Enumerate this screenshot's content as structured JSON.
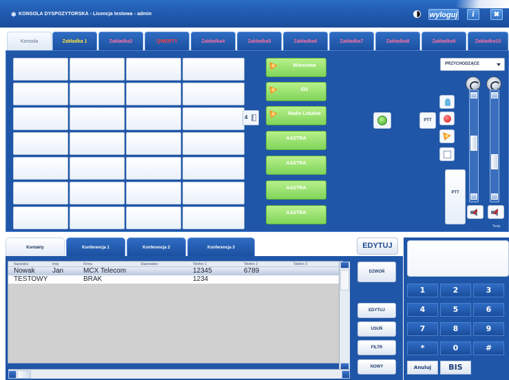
{
  "window": {
    "title": "KONSOLA DYSPOZYTORSKA - Licencja testowa - admin",
    "logout_label": "wyloguj",
    "info_label": "i",
    "close_label": "✖"
  },
  "tabs": [
    {
      "label": "Konsola",
      "color": "#5a6f8f",
      "active": true
    },
    {
      "label": "Zakładka 1",
      "color": "#ffe23a"
    },
    {
      "label": "Zakładka2",
      "color": "#ff6fa0"
    },
    {
      "label": "QWERTY",
      "color": "#ff3a3a"
    },
    {
      "label": "Zakładka4",
      "color": "#ff6fa0"
    },
    {
      "label": "Zakładka5",
      "color": "#ff6fa0"
    },
    {
      "label": "Zakładka6",
      "color": "#ff6fa0"
    },
    {
      "label": "Zakładka7",
      "color": "#ff6fa0"
    },
    {
      "label": "Zakładka8",
      "color": "#ff6fa0"
    },
    {
      "label": "Zakładka9",
      "color": "#ff6fa0"
    },
    {
      "label": "Zakładka10",
      "color": "#ff6fa0"
    }
  ],
  "groups": [
    {
      "label": "Wieszowa",
      "icon": true
    },
    {
      "label": "ID2",
      "icon": true
    },
    {
      "label": "Radio Lokalne",
      "icon": true
    },
    {
      "label": "AASTRA",
      "icon": false
    },
    {
      "label": "AASTRA",
      "icon": false
    },
    {
      "label": "AASTRA",
      "icon": false
    },
    {
      "label": "AASTRA",
      "icon": false
    }
  ],
  "speaker_number": "4",
  "ptt_label": "PTT",
  "ptt_large_label": "PTT",
  "direction_select": "PRZYCHODZĄCE",
  "volume": {
    "left_level": 0.45,
    "right_level": 0.25
  },
  "scale_label": "Testy",
  "contact_tabs": [
    {
      "label": "Kontakty",
      "active": true
    },
    {
      "label": "Konferencja 1"
    },
    {
      "label": "Konferencja 2"
    },
    {
      "label": "Konferencja 3"
    }
  ],
  "table": {
    "columns": [
      "Nazwisko",
      "Imię",
      "Firma",
      "Stanowisko",
      "Telefon 1",
      "Telefon 2",
      "Telefon 3"
    ],
    "rows": [
      [
        "Nowak",
        "Jan",
        "MCX Telecom",
        "",
        "12345",
        "6789",
        ""
      ],
      [
        "TESTOWY",
        "",
        "BRAK",
        "",
        "1234",
        "",
        ""
      ]
    ]
  },
  "edit_big_label": "EDYTUJ",
  "side_buttons": {
    "call": "DZWOŃ",
    "edit": "EDYTUJ",
    "delete": "USUŃ",
    "filter": "FILTR",
    "new": "NOWY"
  },
  "dialpad": {
    "keys": [
      "1",
      "2",
      "3",
      "4",
      "5",
      "6",
      "7",
      "8",
      "9",
      "*",
      "0",
      "#"
    ],
    "cancel": "Anuluj",
    "bis": "BIS"
  }
}
